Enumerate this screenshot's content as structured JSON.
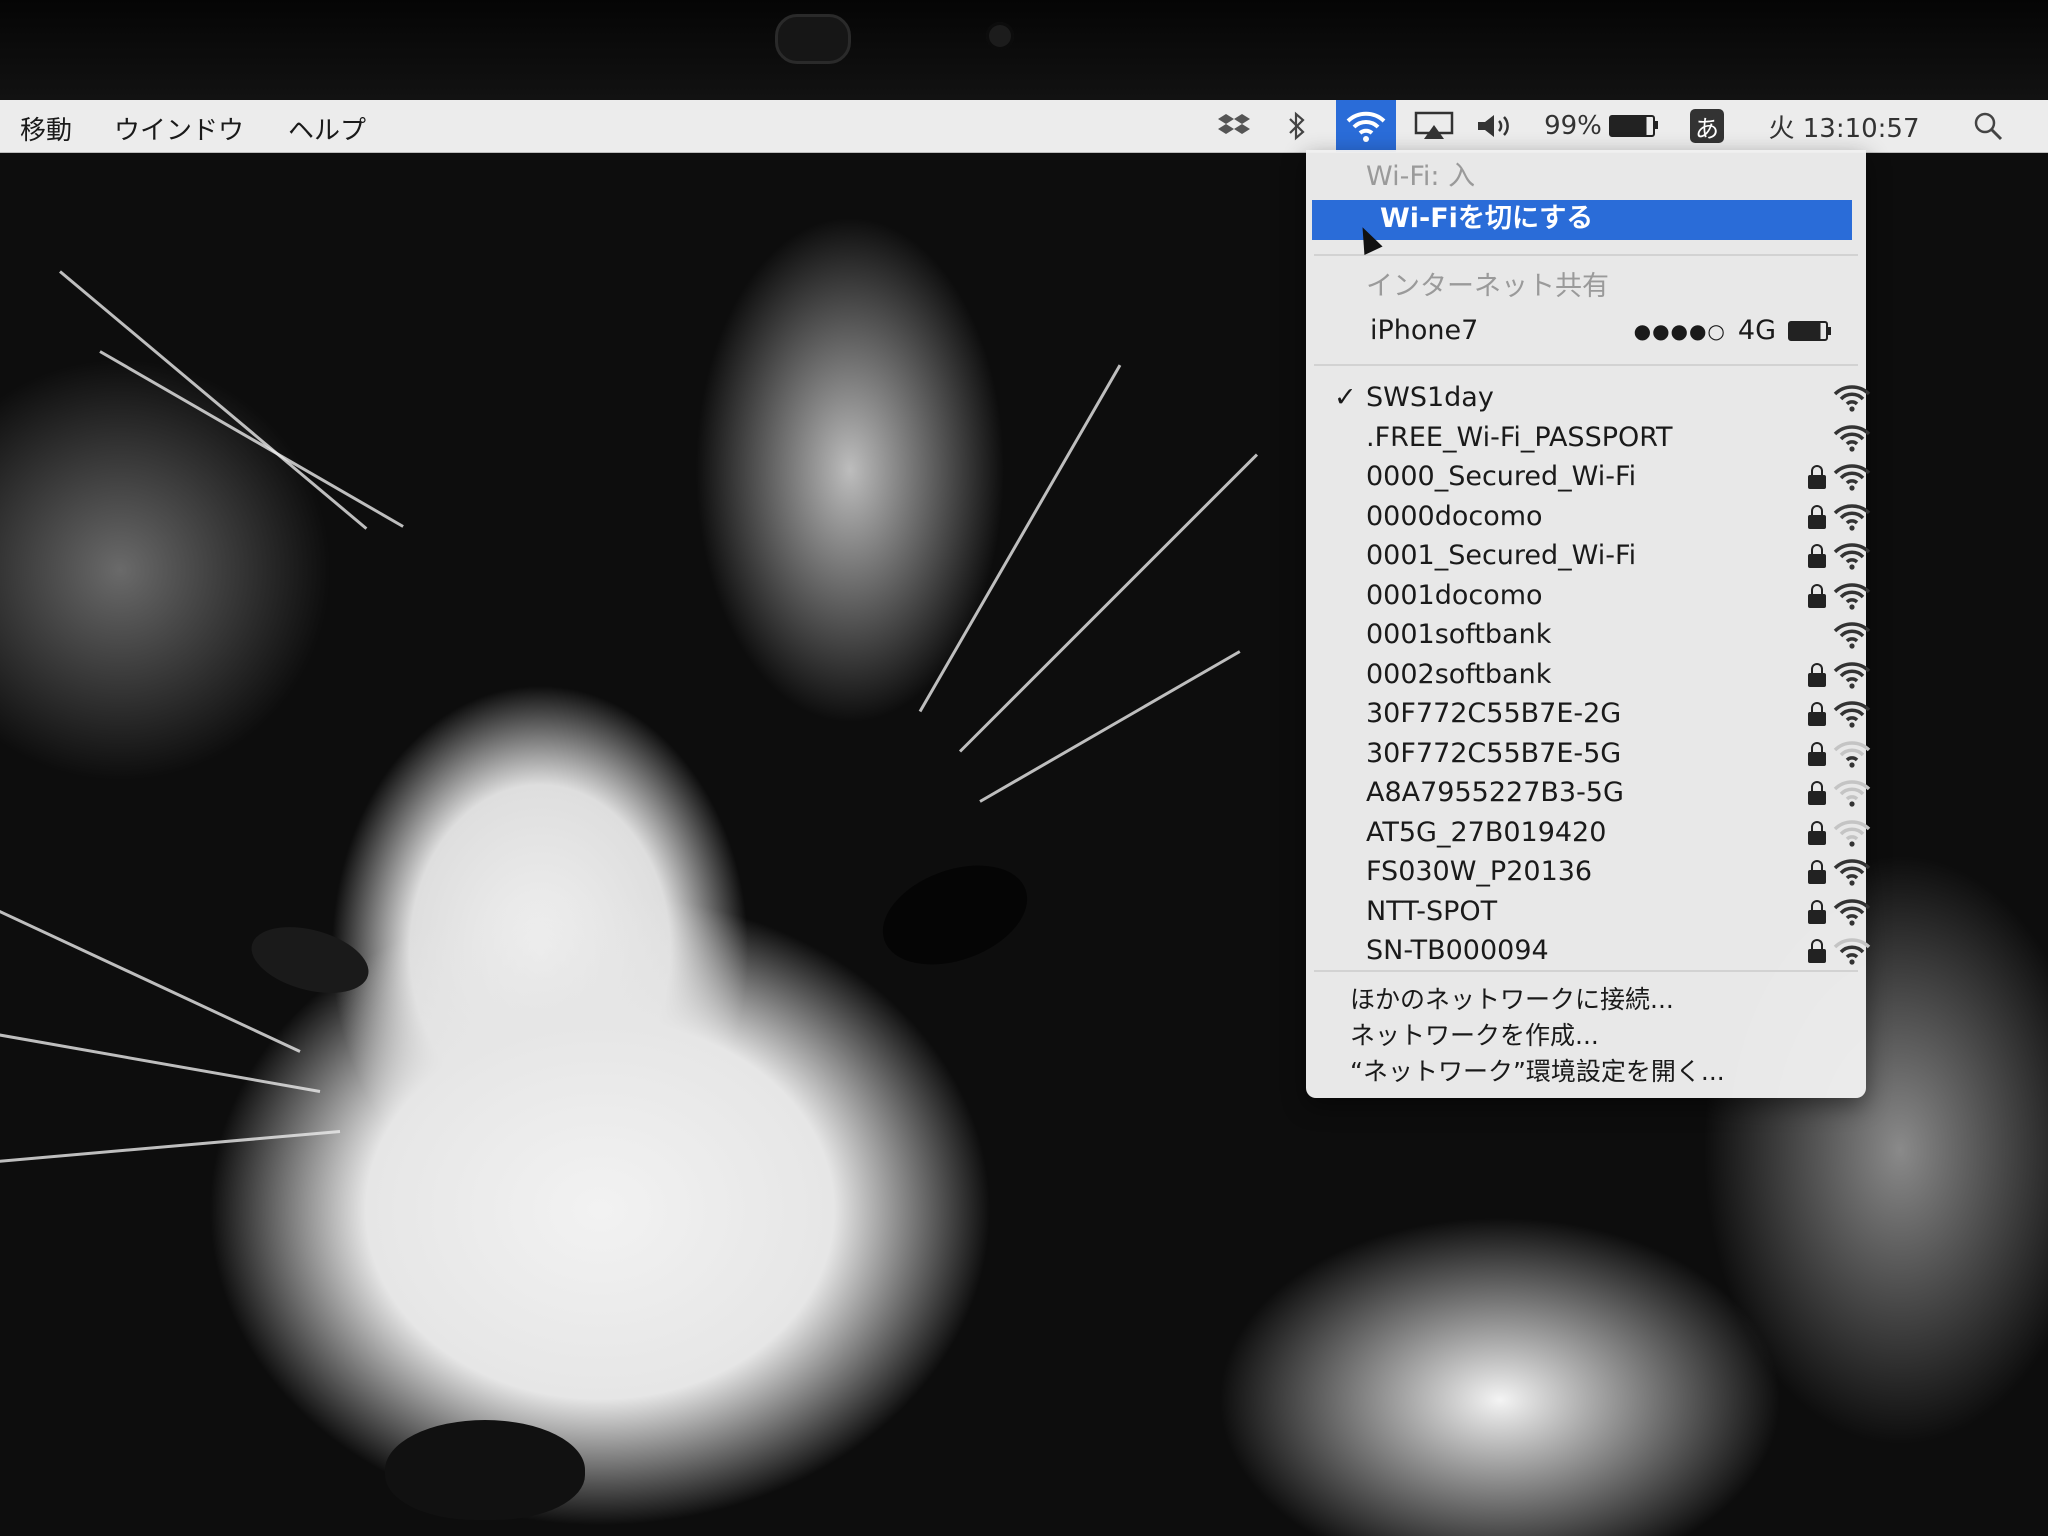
{
  "menubar": {
    "left_menus": [
      "移動",
      "ウインドウ",
      "ヘルプ"
    ],
    "battery_percent": "99%",
    "ime_label": "あ",
    "clock": "火 13:10:57",
    "icons": [
      "dropbox-icon",
      "bluetooth-icon",
      "wifi-icon",
      "airplay-icon",
      "volume-icon",
      "battery-icon",
      "input-method-icon",
      "spotlight-search-icon"
    ]
  },
  "wifi_menu": {
    "status_label": "Wi-Fi: 入",
    "toggle_label": "Wi-Fiを切にする",
    "hotspot_header": "インターネット共有",
    "hotspot": {
      "name": "iPhone7",
      "signal": "●●●●○",
      "network_type": "4G"
    },
    "connected_check": "✓",
    "networks": [
      {
        "name": "SWS1day",
        "connected": true,
        "locked": false,
        "strength": 4
      },
      {
        "name": ".FREE_Wi-Fi_PASSPORT",
        "connected": false,
        "locked": false,
        "strength": 4
      },
      {
        "name": "0000_Secured_Wi-Fi",
        "connected": false,
        "locked": true,
        "strength": 4
      },
      {
        "name": "0000docomo",
        "connected": false,
        "locked": true,
        "strength": 4
      },
      {
        "name": "0001_Secured_Wi-Fi",
        "connected": false,
        "locked": true,
        "strength": 4
      },
      {
        "name": "0001docomo",
        "connected": false,
        "locked": true,
        "strength": 4
      },
      {
        "name": "0001softbank",
        "connected": false,
        "locked": false,
        "strength": 4
      },
      {
        "name": "0002softbank",
        "connected": false,
        "locked": true,
        "strength": 4
      },
      {
        "name": "30F772C55B7E-2G",
        "connected": false,
        "locked": true,
        "strength": 4
      },
      {
        "name": "30F772C55B7E-5G",
        "connected": false,
        "locked": true,
        "strength": 2
      },
      {
        "name": "A8A7955227B3-5G",
        "connected": false,
        "locked": true,
        "strength": 1
      },
      {
        "name": "AT5G_27B019420",
        "connected": false,
        "locked": true,
        "strength": 1
      },
      {
        "name": "FS030W_P20136",
        "connected": false,
        "locked": true,
        "strength": 4
      },
      {
        "name": "NTT-SPOT",
        "connected": false,
        "locked": true,
        "strength": 4
      },
      {
        "name": "SN-TB000094",
        "connected": false,
        "locked": true,
        "strength": 3
      }
    ],
    "footer_items": [
      "ほかのネットワークに接続...",
      "ネットワークを作成...",
      "“ネットワーク”環境設定を開く..."
    ]
  }
}
